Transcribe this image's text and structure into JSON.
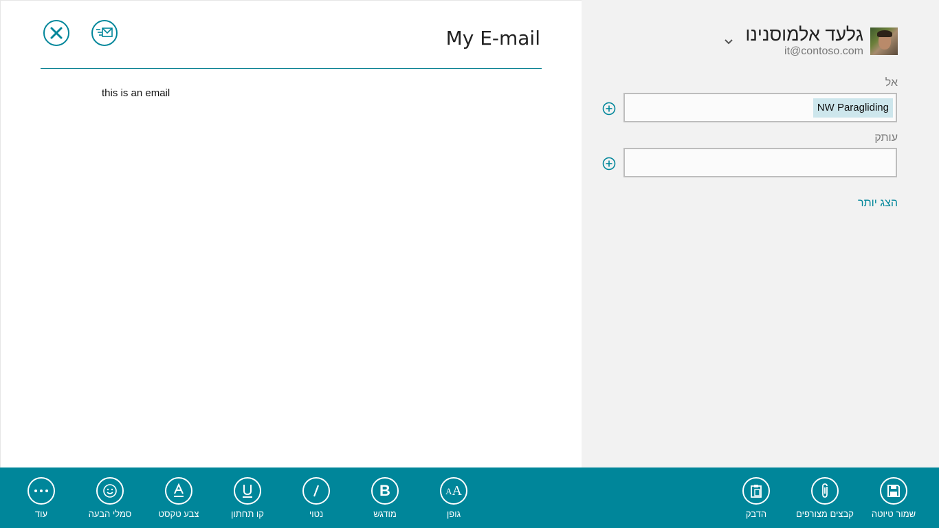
{
  "compose": {
    "subject": "My E-mail",
    "body": "this is an email"
  },
  "sender": {
    "name": "גלעד אלמוסנינו",
    "email": "it@contoso.com"
  },
  "fields": {
    "to_label": "אל",
    "to_recipient": "NW Paragliding",
    "cc_label": "עותק",
    "show_more": "הצג יותר"
  },
  "app_bar": {
    "left": [
      {
        "label": "עוד",
        "icon": "more-icon"
      },
      {
        "label": "סמלי הבעה",
        "icon": "emoji-icon"
      },
      {
        "label": "צבע טקסט",
        "icon": "text-color-icon"
      },
      {
        "label": "קו תחתון",
        "icon": "underline-icon"
      },
      {
        "label": "נטוי",
        "icon": "italic-icon"
      },
      {
        "label": "מודגש",
        "icon": "bold-icon"
      },
      {
        "label": "גופן",
        "icon": "font-icon"
      }
    ],
    "right": [
      {
        "label": "הדבק",
        "icon": "paste-icon"
      },
      {
        "label": "קבצים מצורפים",
        "icon": "attachment-icon"
      },
      {
        "label": "שמור טיוטה",
        "icon": "save-icon"
      }
    ]
  },
  "colors": {
    "accent": "#00869a",
    "side_pane": "#f2f2f2",
    "chip": "#cde6ec"
  }
}
